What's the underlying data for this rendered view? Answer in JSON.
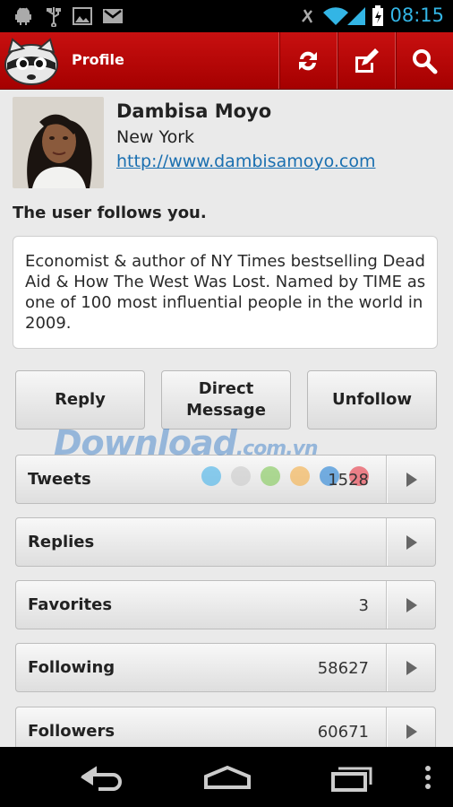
{
  "status_bar": {
    "time": "08:15",
    "icons": [
      "android-debug-icon",
      "usb-icon",
      "picture-icon",
      "gmail-icon",
      "mute-icon",
      "wifi-icon",
      "signal-icon",
      "battery-charging-icon"
    ]
  },
  "action_bar": {
    "title": "Profile",
    "logo_icon": "raccoon-logo-icon",
    "buttons": [
      {
        "name": "refresh-icon"
      },
      {
        "name": "compose-icon"
      },
      {
        "name": "search-icon"
      }
    ],
    "color": "#b30b0b"
  },
  "profile": {
    "name": "Dambisa Moyo",
    "location": "New York",
    "url": "http://www.dambisamoyo.com",
    "follow_status": "The user follows you.",
    "bio": "Economist & author of NY Times bestselling Dead Aid & How The West Was Lost. Named by TIME as one of 100 most influential people in the world in 2009."
  },
  "actions": {
    "reply": "Reply",
    "direct_message": "Direct Message",
    "unfollow": "Unfollow"
  },
  "watermark": {
    "main": "Download",
    "suffix": ".com.vn"
  },
  "stats": [
    {
      "label": "Tweets",
      "count": "1528"
    },
    {
      "label": "Replies",
      "count": ""
    },
    {
      "label": "Favorites",
      "count": "3"
    },
    {
      "label": "Following",
      "count": "58627"
    },
    {
      "label": "Followers",
      "count": "60671"
    }
  ],
  "dot_colors": [
    "#5ab9ea",
    "#cfcfcf",
    "#8fcd6a",
    "#f3b65b",
    "#3c8fd8",
    "#e8505b"
  ],
  "nav_bar": {
    "buttons": [
      "back-icon",
      "home-icon",
      "recent-apps-icon",
      "menu-icon"
    ]
  }
}
